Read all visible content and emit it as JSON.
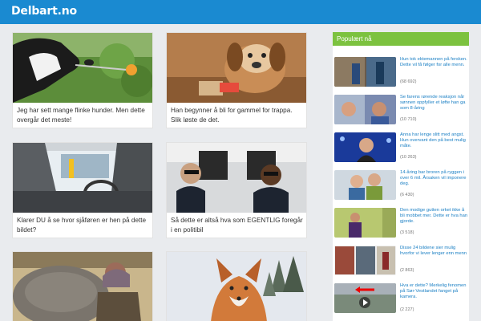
{
  "site": {
    "logo": "Delbart.no"
  },
  "articles": [
    {
      "caption": "Jeg har sett mange flinke hunder. Men dette overgår det meste!",
      "thumb_icon": "dog-with-spoon-image"
    },
    {
      "caption": "Han begynner å bli for gammel for trappa. Slik løste de det.",
      "thumb_icon": "old-dog-image"
    },
    {
      "caption": "Klarer DU å se hvor sjåføren er hen på dette bildet?",
      "thumb_icon": "car-interior-image"
    },
    {
      "caption": "Så dette er altså hva som EGENTLIG foregår i en politibil",
      "thumb_icon": "police-car-image"
    },
    {
      "caption": "",
      "thumb_icon": "elephant-image"
    },
    {
      "caption": "",
      "thumb_icon": "fox-in-snow-image"
    }
  ],
  "popular": {
    "header": "Populært nå",
    "items": [
      {
        "title": "Hun tok ektemannen på fersken. Dette vil få følger for alle menn.",
        "count": "(68 692)"
      },
      {
        "title": "Se farens rørende reaksjon når sønnen oppfyller et løfte han ga som 8-åring",
        "count": "(10 710)"
      },
      {
        "title": "Anna har lenge slitt med angst. Hun overvant den på best mulig måte.",
        "count": "(10 263)"
      },
      {
        "title": "14-åring bar broren på ryggen i over 6 mil. Årsaken vil imponere deg.",
        "count": "(6 430)"
      },
      {
        "title": "Den modige gutten orket ikke å bli mobbet mer. Dette er hva han gjorde.",
        "count": "(3 518)"
      },
      {
        "title": "Disse 24 bildene sier mulig hvorfor vi lever lenger enn menn",
        "count": "(2 863)"
      },
      {
        "title": "Hva er dette? Merkelig fenomen på Sør-Vestlandet fanget på kamera.",
        "count": "(2 227)"
      }
    ]
  },
  "colors": {
    "brand_blue": "#1a8ad1",
    "popular_green": "#7cc23f",
    "link_blue": "#1a7fc4",
    "background": "#e9ebee"
  }
}
